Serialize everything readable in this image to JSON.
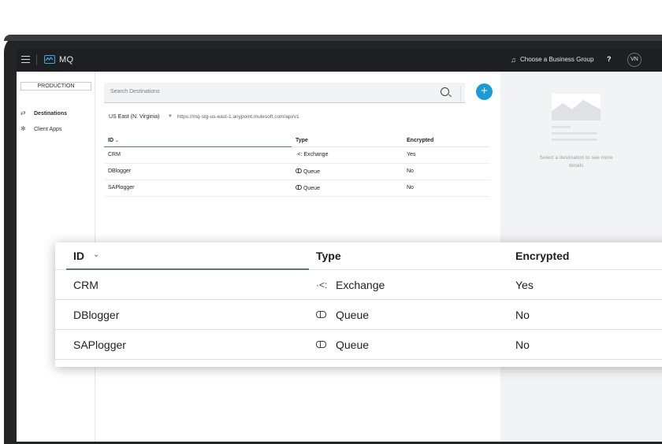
{
  "nav": {
    "app_name": "MQ",
    "business_group": "Choose a Business Group",
    "help": "?",
    "avatar": "VN"
  },
  "sidebar": {
    "environment": "PRODUCTION",
    "items": [
      {
        "label": "Destinations",
        "icon": "destinations-icon",
        "active": true
      },
      {
        "label": "Client Apps",
        "icon": "client-apps-icon",
        "active": false
      }
    ]
  },
  "main": {
    "search_placeholder": "Search Destinations",
    "region": "US East (N. Virginia)",
    "url": "https://mq-stg-us-east-1.anypoint.mulesoft.com/api/v1",
    "columns": [
      "ID",
      "Type",
      "Encrypted"
    ],
    "rows": [
      {
        "id": "CRM",
        "type": "Exchange",
        "type_icon": "exchange-icon",
        "encrypted": "Yes"
      },
      {
        "id": "DBlogger",
        "type": "Queue",
        "type_icon": "queue-icon",
        "encrypted": "No"
      },
      {
        "id": "SAPlogger",
        "type": "Queue",
        "type_icon": "queue-icon",
        "encrypted": "No"
      }
    ]
  },
  "details": {
    "empty_text": "Select a destination to see more details"
  },
  "colors": {
    "navbar": "#1d1f23",
    "accent": "#1a9bd7",
    "underline": "#58748a",
    "panel": "#f2f3f4"
  }
}
